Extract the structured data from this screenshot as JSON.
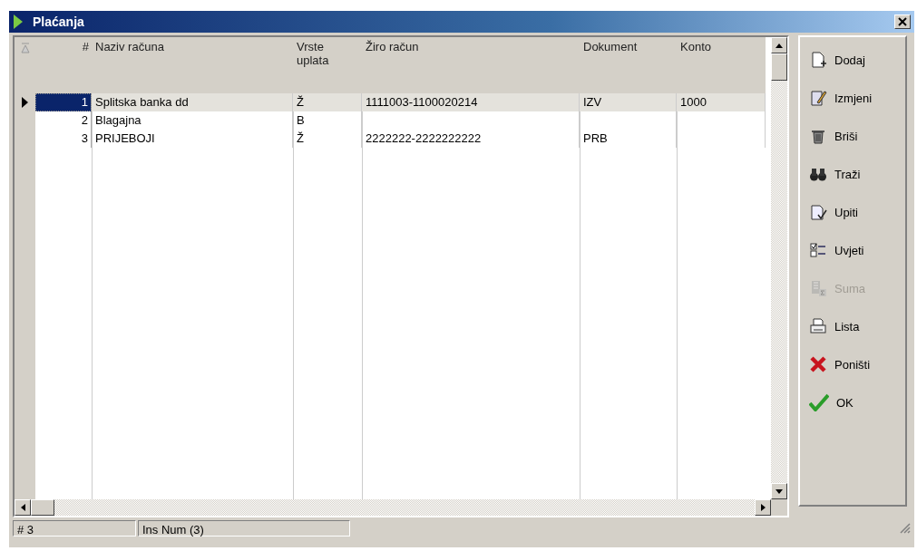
{
  "window": {
    "title": "Plaćanja"
  },
  "table": {
    "columns": [
      "#",
      "Naziv računa",
      "Vrste uplata",
      "Žiro račun",
      "Dokument",
      "Konto"
    ],
    "rows": [
      {
        "cells": [
          "1",
          "Splitska banka dd",
          "Ž",
          "1111003-1100020214",
          "IZV",
          "1000"
        ],
        "selected": true
      },
      {
        "cells": [
          "2",
          "Blagajna",
          "B",
          "",
          "",
          ""
        ],
        "selected": false
      },
      {
        "cells": [
          "3",
          "PRIJEBOJI",
          "Ž",
          "2222222-2222222222",
          "PRB",
          ""
        ],
        "selected": false
      }
    ]
  },
  "buttons": [
    {
      "kind": "add",
      "label": "Dodaj",
      "disabled": false
    },
    {
      "kind": "edit",
      "label": "Izmjeni",
      "disabled": false
    },
    {
      "kind": "delete",
      "label": "Briši",
      "disabled": false
    },
    {
      "kind": "find",
      "label": "Traži",
      "disabled": false
    },
    {
      "kind": "query",
      "label": "Upiti",
      "disabled": false
    },
    {
      "kind": "conditions",
      "label": "Uvjeti",
      "disabled": false
    },
    {
      "kind": "sum",
      "label": "Suma",
      "disabled": true
    },
    {
      "kind": "print",
      "label": "Lista",
      "disabled": false
    },
    {
      "kind": "cancel",
      "label": "Poništi",
      "disabled": false
    },
    {
      "kind": "ok",
      "label": "OK",
      "disabled": false
    }
  ],
  "status_bar": [
    "# 3",
    "Ins Num (3)"
  ]
}
